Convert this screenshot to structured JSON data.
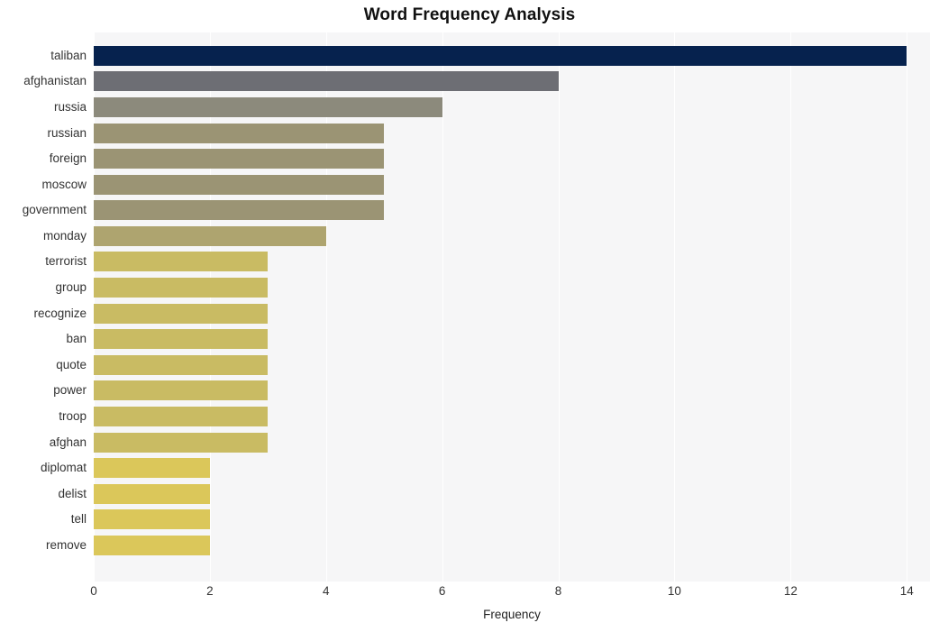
{
  "chart_data": {
    "type": "bar",
    "orientation": "horizontal",
    "title": "Word Frequency Analysis",
    "xlabel": "Frequency",
    "ylabel": "",
    "xlim": [
      0,
      14.4
    ],
    "ylim": [
      0,
      20
    ],
    "grid": true,
    "legend": null,
    "xticks": [
      "0",
      "2",
      "4",
      "6",
      "8",
      "10",
      "12",
      "14"
    ],
    "xtick_values": [
      0,
      2,
      4,
      6,
      8,
      10,
      12,
      14
    ],
    "categories": [
      "taliban",
      "afghanistan",
      "russia",
      "russian",
      "foreign",
      "moscow",
      "government",
      "monday",
      "terrorist",
      "group",
      "recognize",
      "ban",
      "quote",
      "power",
      "troop",
      "afghan",
      "diplomat",
      "delist",
      "tell",
      "remove"
    ],
    "values": [
      14,
      8,
      6,
      5,
      5,
      5,
      5,
      4,
      3,
      3,
      3,
      3,
      3,
      3,
      3,
      3,
      2,
      2,
      2,
      2
    ],
    "bar_colors": [
      "#06224e",
      "#6d6e74",
      "#8c8a7c",
      "#9b9474",
      "#9b9474",
      "#9b9474",
      "#9b9474",
      "#aea46f",
      "#c9bb63",
      "#c9bb63",
      "#c9bb63",
      "#c9bb63",
      "#c9bb63",
      "#c9bb63",
      "#c9bb63",
      "#c9bb63",
      "#dbc75a",
      "#dbc75a",
      "#dbc75a",
      "#dbc75a"
    ],
    "plot_background": "#f6f6f7",
    "gridline_color": "#ffffff",
    "figure_background": "#ffffff"
  }
}
